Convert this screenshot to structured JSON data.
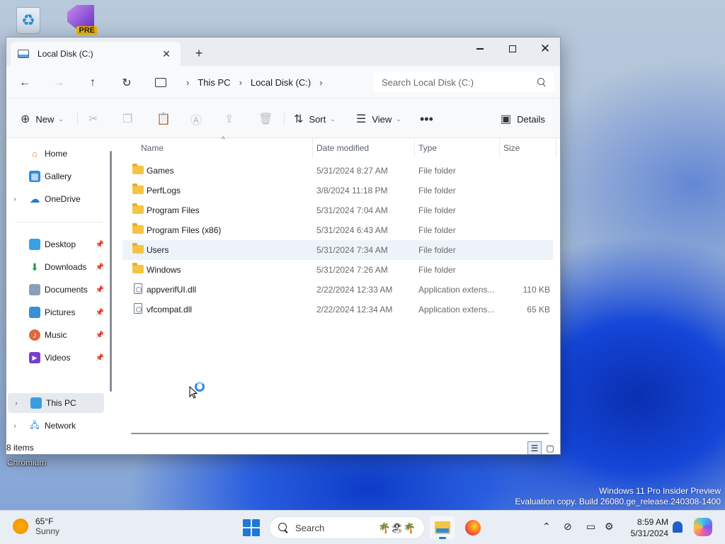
{
  "desktop": {
    "chromium_label": "Chromium",
    "vs_badge": "PRE",
    "watermark_line1": "Windows 11 Pro Insider Preview",
    "watermark_line2": "Evaluation copy. Build 26080.ge_release.240308-1400"
  },
  "window": {
    "tab_title": "Local Disk (C:)",
    "breadcrumb": [
      "This PC",
      "Local Disk (C:)"
    ],
    "search_placeholder": "Search Local Disk (C:)",
    "commands": {
      "new_label": "New",
      "sort_label": "Sort",
      "view_label": "View",
      "details_label": "Details"
    },
    "nav": {
      "home": "Home",
      "gallery": "Gallery",
      "onedrive": "OneDrive",
      "desktop": "Desktop",
      "downloads": "Downloads",
      "documents": "Documents",
      "pictures": "Pictures",
      "music": "Music",
      "videos": "Videos",
      "thispc": "This PC",
      "network": "Network"
    },
    "columns": {
      "name": "Name",
      "date": "Date modified",
      "type": "Type",
      "size": "Size"
    },
    "files": [
      {
        "name": "Games",
        "date": "5/31/2024 8:27 AM",
        "type": "File folder",
        "size": "",
        "icon": "folder-icon"
      },
      {
        "name": "PerfLogs",
        "date": "3/8/2024 11:18 PM",
        "type": "File folder",
        "size": "",
        "icon": "folder-icon"
      },
      {
        "name": "Program Files",
        "date": "5/31/2024 7:04 AM",
        "type": "File folder",
        "size": "",
        "icon": "folder-icon"
      },
      {
        "name": "Program Files (x86)",
        "date": "5/31/2024 6:43 AM",
        "type": "File folder",
        "size": "",
        "icon": "folder-icon"
      },
      {
        "name": "Users",
        "date": "5/31/2024 7:34 AM",
        "type": "File folder",
        "size": "",
        "icon": "folder-icon"
      },
      {
        "name": "Windows",
        "date": "5/31/2024 7:26 AM",
        "type": "File folder",
        "size": "",
        "icon": "folder-icon"
      },
      {
        "name": "appverifUI.dll",
        "date": "2/22/2024 12:33 AM",
        "type": "Application extens...",
        "size": "110 KB",
        "icon": "dll-file-icon"
      },
      {
        "name": "vfcompat.dll",
        "date": "2/22/2024 12:34 AM",
        "type": "Application extens...",
        "size": "65 KB",
        "icon": "dll-file-icon"
      }
    ],
    "status_count": "8 items"
  },
  "taskbar": {
    "temp": "65°F",
    "condition": "Sunny",
    "search_label": "Search",
    "time": "8:59 AM",
    "date": "5/31/2024"
  }
}
